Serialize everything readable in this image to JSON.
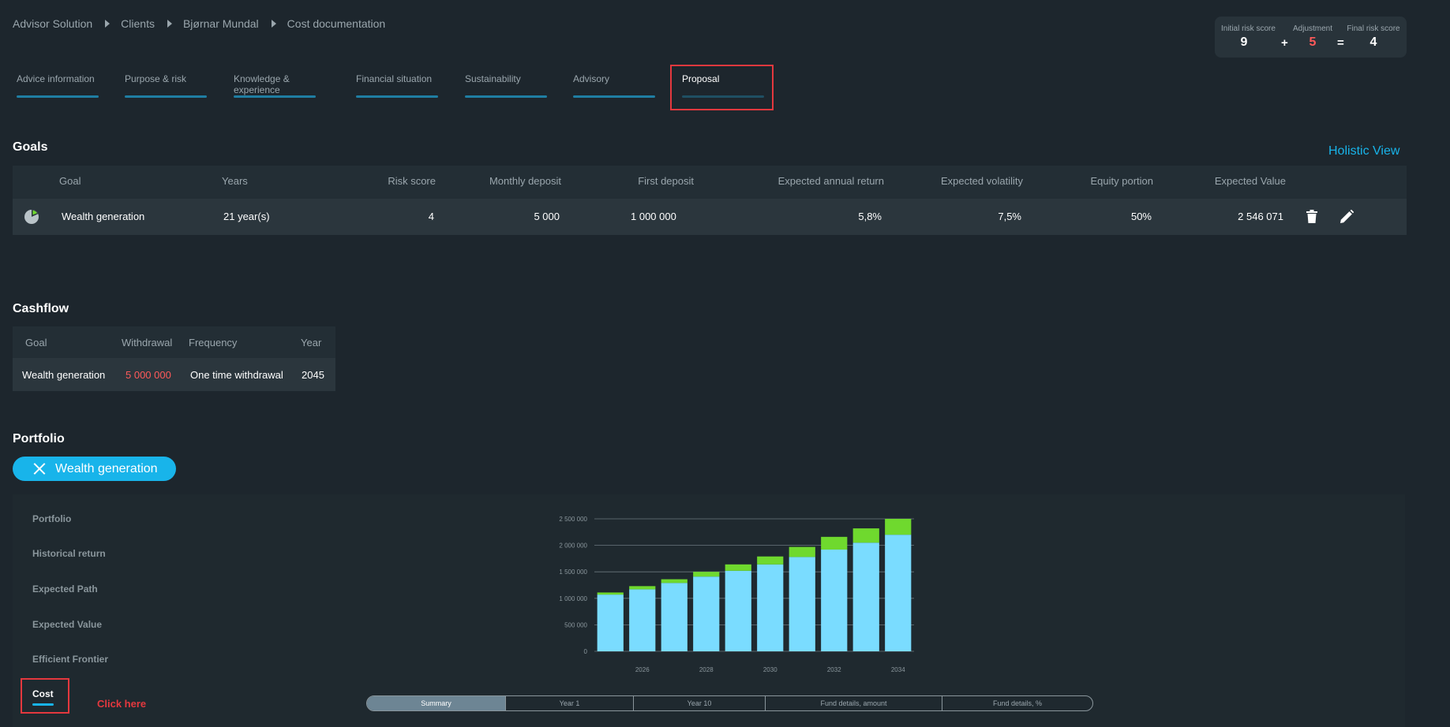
{
  "breadcrumb": [
    "Advisor Solution",
    "Clients",
    "Bjørnar Mundal",
    "Cost documentation"
  ],
  "risk": {
    "initial_label": "Initial risk score",
    "initial_value": "9",
    "adjustment_label": "Adjustment",
    "adjustment_value": "5",
    "final_label": "Final risk score",
    "final_value": "4",
    "plus": "+",
    "equals": "=",
    "adjustment_color": "#ff5a5a"
  },
  "tabs": [
    {
      "label": "Advice information"
    },
    {
      "label": "Purpose & risk"
    },
    {
      "label": "Knowledge & experience"
    },
    {
      "label": "Financial situation"
    },
    {
      "label": "Sustainability"
    },
    {
      "label": "Advisory"
    },
    {
      "label": "Proposal",
      "active": true
    }
  ],
  "goals": {
    "title": "Goals",
    "holistic_view": "Holistic View",
    "columns": [
      "Goal",
      "Years",
      "Risk score",
      "Monthly deposit",
      "First deposit",
      "Expected annual return",
      "Expected volatility",
      "Equity portion",
      "Expected Value"
    ],
    "row": {
      "icon": "pie-chart-icon",
      "goal": "Wealth generation",
      "years": "21 year(s)",
      "risk_score": "4",
      "monthly_deposit": "5 000",
      "first_deposit": "1 000 000",
      "expected_annual_return": "5,8%",
      "expected_volatility": "7,5%",
      "equity_portion": "50%",
      "expected_value": "2 546 071"
    }
  },
  "cashflow": {
    "title": "Cashflow",
    "columns": [
      "Goal",
      "Withdrawal",
      "Frequency",
      "Year"
    ],
    "row": {
      "goal": "Wealth generation",
      "withdrawal": "5 000 000",
      "frequency": "One time withdrawal",
      "year": "2045"
    },
    "withdrawal_color": "#ff5a5a"
  },
  "portfolio": {
    "title": "Portfolio",
    "chip_label": "Wealth generation",
    "menu": [
      "Portfolio",
      "Historical return",
      "Expected Path",
      "Expected Value",
      "Efficient Frontier"
    ],
    "cost_label": "Cost",
    "annotation": "Click here",
    "segments": [
      "Summary",
      "Year 1",
      "Year 10",
      "Fund details, amount",
      "Fund details, %"
    ]
  },
  "chart_data": {
    "type": "bar",
    "stacked": true,
    "categories": [
      "2025",
      "2026",
      "2027",
      "2028",
      "2029",
      "2030",
      "2031",
      "2032",
      "2033",
      "2034"
    ],
    "x_tick_labels": [
      "",
      "2026",
      "",
      "2028",
      "",
      "2030",
      "",
      "2032",
      "",
      "2034"
    ],
    "series": [
      {
        "values": [
          1070000,
          1170000,
          1290000,
          1410000,
          1520000,
          1640000,
          1780000,
          1920000,
          2050000,
          2200000
        ],
        "color": "#7adcff"
      },
      {
        "values": [
          40000,
          60000,
          70000,
          90000,
          120000,
          150000,
          190000,
          240000,
          270000,
          300000
        ],
        "color": "#6fd92e"
      }
    ],
    "ylim": [
      0,
      2500000
    ],
    "y_ticks": [
      0,
      500000,
      1000000,
      1500000,
      2000000,
      2500000
    ],
    "y_tick_labels": [
      "0",
      "500 000",
      "1 000 000",
      "1 500 000",
      "2 000 000",
      "2 500 000"
    ],
    "grid": true
  }
}
